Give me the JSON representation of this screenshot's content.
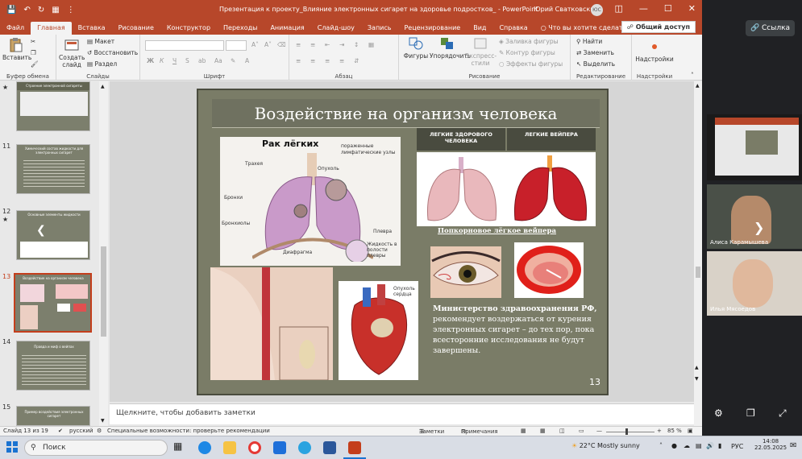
{
  "window": {
    "title": "Презентация к проекту_Влияние электронных сигарет на здоровье подростков_ - PowerPoint",
    "user": "Юрий Сватковский",
    "avatar": "ЮС"
  },
  "quick_access": [
    "save-icon",
    "undo-icon",
    "redo-icon",
    "present-icon",
    "more-icon"
  ],
  "tabs": [
    "Файл",
    "Главная",
    "Вставка",
    "Рисование",
    "Конструктор",
    "Переходы",
    "Анимация",
    "Слайд-шоу",
    "Запись",
    "Рецензирование",
    "Вид",
    "Справка"
  ],
  "active_tab": "Главная",
  "tell_me": "Что вы хотите сделать?",
  "share_label": "Общий доступ",
  "ribbon": {
    "clipboard": {
      "paste": "Вставить",
      "label": "Буфер обмена"
    },
    "slides": {
      "new_slide": "Создать слайд",
      "layout": "Макет",
      "reset": "Восстановить",
      "section": "Раздел",
      "label": "Слайды"
    },
    "font": {
      "bold": "Ж",
      "italic": "К",
      "underline": "Ч",
      "strike": "S",
      "label": "Шрифт"
    },
    "paragraph": {
      "label": "Абзац"
    },
    "drawing": {
      "shapes": "Фигуры",
      "arrange": "Упорядочить",
      "quick_styles": "Экспресс-стили",
      "fill": "Заливка фигуры",
      "outline": "Контур фигуры",
      "effects": "Эффекты фигуры",
      "label": "Рисование"
    },
    "editing": {
      "find": "Найти",
      "replace": "Заменить",
      "select": "Выделить",
      "label": "Редактирование"
    },
    "addins": {
      "addins": "Надстройки",
      "label": "Надстройки"
    }
  },
  "thumbnails": [
    {
      "num": "",
      "title": "Строение электронной сигареты"
    },
    {
      "num": "11",
      "title": "Химический состав жидкости для электронных сигарет"
    },
    {
      "num": "12",
      "title": "Основные элементы жидкости"
    },
    {
      "num": "13",
      "title": "Воздействие на организм человека"
    },
    {
      "num": "14",
      "title": "Правда и миф о вейпах"
    },
    {
      "num": "15",
      "title": "Пример воздействия электронных сигарет"
    }
  ],
  "slide": {
    "title": "Воздействие на организм человека",
    "lung_cancer_title": "Рак лёгких",
    "lung_labels": [
      "Трахея",
      "Опухоль",
      "пораженные лимфатические узлы",
      "Бронхи",
      "Бронхиолы",
      "Диафрагма",
      "Плевра",
      "Жидкость в полости плевры"
    ],
    "table_headers": [
      "ЛЕГКИЕ ЗДОРОВОГО ЧЕЛОВЕКА",
      "ЛЕГКИЕ ВЕЙПЕРА"
    ],
    "popcorn_caption": "Попкорновое лёгкое вейпера",
    "heart_label": "Опухоль сердца",
    "body_bold": "Министерство здравоохранения РФ,",
    "body_rest": " рекомендует воздержаться от курения электронных сигарет – до тех пор, пока всесторонние исследования не будут завершены.",
    "page_number": "13"
  },
  "notes_placeholder": "Щелкните, чтобы добавить заметки",
  "status": {
    "slide_of": "Слайд 13 из 19",
    "language": "русский",
    "accessibility": "Специальные возможности: проверьте рекомендации",
    "notes": "Заметки",
    "comments": "Примечания",
    "zoom": "85 %"
  },
  "meeting": {
    "link_button": "Ссылка",
    "participants": [
      "Алиса Карамышева",
      "Илья Мясоедов"
    ]
  },
  "taskbar": {
    "search": "Поиск",
    "weather": "22°C  Mostly sunny",
    "lang": "РУС",
    "time": "14:08",
    "date": "22.05.2025"
  }
}
